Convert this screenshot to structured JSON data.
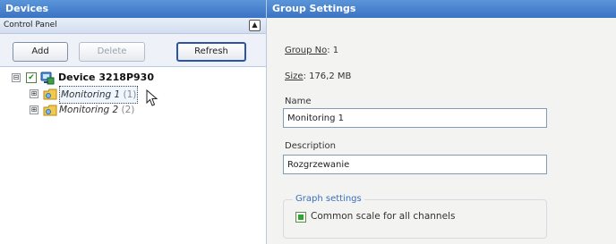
{
  "left_panel": {
    "title": "Devices",
    "subtitle": "Control Panel",
    "collapse_glyph": "▲",
    "toolbar": {
      "add_label": "Add",
      "delete_label": "Delete",
      "refresh_label": "Refresh"
    },
    "tree": {
      "device": {
        "label": "Device 3218P930",
        "expander": "⊟",
        "checked": true,
        "icon": "device-icon"
      },
      "groups": [
        {
          "label": "Monitoring 1",
          "count": "(1)",
          "expander": "⊞",
          "icon": "group-icon",
          "selected": true
        },
        {
          "label": "Monitoring 2",
          "count": "(2)",
          "expander": "⊞",
          "icon": "group-icon",
          "selected": false
        }
      ]
    }
  },
  "right_panel": {
    "title": "Group Settings",
    "group_no_label": "Group No",
    "group_no_value": ": 1",
    "size_label": "Size",
    "size_value": ": 176,2 MB",
    "name_label": "Name",
    "name_value": "Monitoring 1",
    "description_label": "Description",
    "description_value": "Rozgrzewanie",
    "graph_settings": {
      "title": "Graph settings",
      "common_scale_label": "Common scale for all channels",
      "common_scale_checked": true
    }
  },
  "colors": {
    "header_blue": "#3b73c4",
    "accent_blue": "#3a6fbf",
    "checkbox_green": "#2ea52e"
  }
}
